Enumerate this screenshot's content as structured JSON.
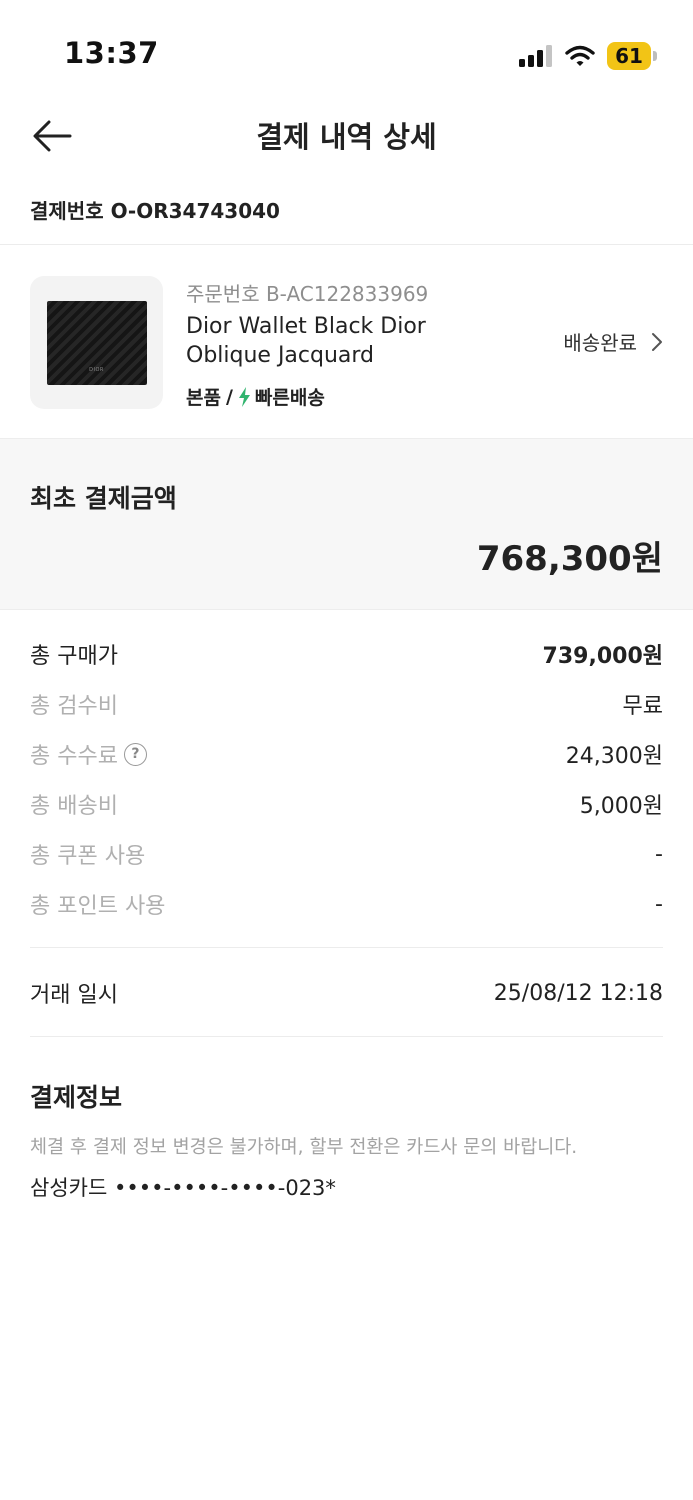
{
  "status_bar": {
    "time": "13:37",
    "battery": "61",
    "icons": [
      "signal-icon",
      "wifi-icon",
      "battery-icon"
    ]
  },
  "nav": {
    "back_icon": "arrow-left-icon",
    "title": "결제 내역 상세"
  },
  "payment_number": "결제번호 O-OR34743040",
  "product": {
    "order_number": "주문번호 B-AC122833969",
    "name": "Dior Wallet Black Dior Oblique Jacquard",
    "thumbnail_logo": "DIOR",
    "tag_original": "본품",
    "tag_separator": "/",
    "tag_fast": "빠른배송",
    "fast_icon": "lightning-icon",
    "fast_icon_color": "#31b46e",
    "delivery_status": "배송완료",
    "delivery_chevron": "chevron-right-icon"
  },
  "initial_payment": {
    "label": "최초 결제금액",
    "amount": "768,300원"
  },
  "breakdown": [
    {
      "label": "총 구매가",
      "value": "739,000원"
    },
    {
      "label": "총 검수비",
      "value": "무료"
    },
    {
      "label": "총 수수료",
      "value": "24,300원",
      "help_icon": "?"
    },
    {
      "label": "총 배송비",
      "value": "5,000원"
    },
    {
      "label": "총 쿠폰 사용",
      "value": "-"
    },
    {
      "label": "총 포인트 사용",
      "value": "-"
    }
  ],
  "transaction": {
    "label": "거래 일시",
    "value": "25/08/12 12:18"
  },
  "payment_info": {
    "title": "결제정보",
    "notice": "체결 후 결제 정보 변경은 불가하며, 할부 전환은 카드사 문의 바랍니다.",
    "card": "삼성카드 ••••-••••-••••-023*"
  },
  "colors": {
    "battery": "#f2c416",
    "summary_background": "#f7f7f7",
    "muted_text": "#b0b0b0"
  }
}
